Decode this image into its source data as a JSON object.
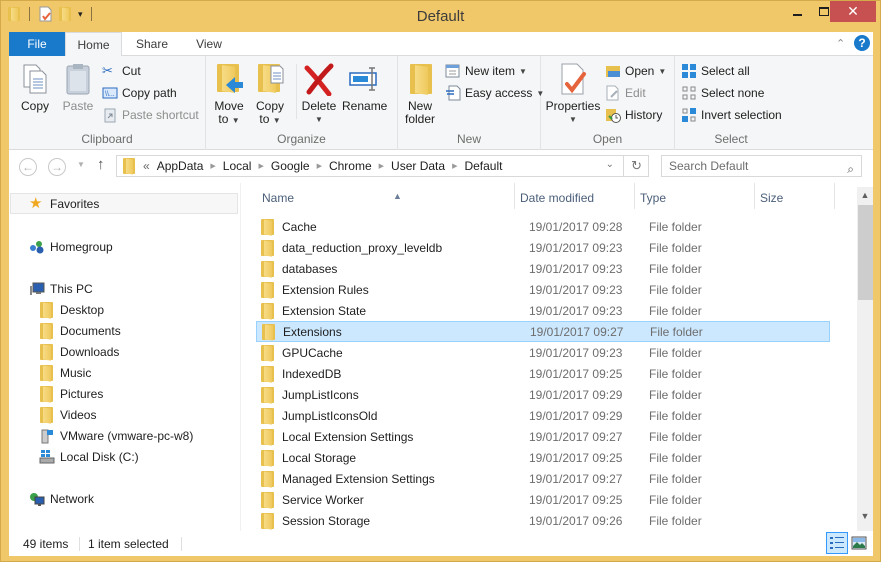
{
  "window": {
    "title": "Default",
    "accent_color": "#f0c86a",
    "close_color": "#c75050"
  },
  "quick_access": {
    "icons": [
      "folder-icon",
      "properties-icon",
      "new-folder-icon",
      "customize-dropdown-icon"
    ]
  },
  "tabs": [
    {
      "label": "File",
      "active": false
    },
    {
      "label": "Home",
      "active": true
    },
    {
      "label": "Share",
      "active": false
    },
    {
      "label": "View",
      "active": false
    }
  ],
  "ribbon": {
    "clipboard": {
      "label": "Clipboard",
      "copy": "Copy",
      "paste": "Paste",
      "cut": "Cut",
      "copy_path": "Copy path",
      "paste_shortcut": "Paste shortcut"
    },
    "organize": {
      "label": "Organize",
      "move_to_1": "Move",
      "move_to_2": "to",
      "copy_to_1": "Copy",
      "copy_to_2": "to",
      "delete": "Delete",
      "rename": "Rename"
    },
    "new": {
      "label": "New",
      "new_folder_1": "New",
      "new_folder_2": "folder",
      "new_item": "New item",
      "easy_access": "Easy access"
    },
    "open": {
      "label": "Open",
      "properties": "Properties",
      "open": "Open",
      "edit": "Edit",
      "history": "History"
    },
    "select": {
      "label": "Select",
      "select_all": "Select all",
      "select_none": "Select none",
      "invert_selection": "Invert selection"
    }
  },
  "address": {
    "overflow": "«",
    "crumbs": [
      "AppData",
      "Local",
      "Google",
      "Chrome",
      "User Data",
      "Default"
    ],
    "search_placeholder": "Search Default"
  },
  "navpane": {
    "favorites": "Favorites",
    "homegroup": "Homegroup",
    "this_pc": "This PC",
    "pc_items": [
      "Desktop",
      "Documents",
      "Downloads",
      "Music",
      "Pictures",
      "Videos",
      "VMware (vmware-pc-w8)",
      "Local Disk (C:)"
    ],
    "network": "Network"
  },
  "columns": {
    "name": "Name",
    "date": "Date modified",
    "type": "Type",
    "size": "Size"
  },
  "files": [
    {
      "name": "Cache",
      "date": "19/01/2017 09:28",
      "type": "File folder",
      "selected": false
    },
    {
      "name": "data_reduction_proxy_leveldb",
      "date": "19/01/2017 09:23",
      "type": "File folder",
      "selected": false
    },
    {
      "name": "databases",
      "date": "19/01/2017 09:23",
      "type": "File folder",
      "selected": false
    },
    {
      "name": "Extension Rules",
      "date": "19/01/2017 09:23",
      "type": "File folder",
      "selected": false
    },
    {
      "name": "Extension State",
      "date": "19/01/2017 09:23",
      "type": "File folder",
      "selected": false
    },
    {
      "name": "Extensions",
      "date": "19/01/2017 09:27",
      "type": "File folder",
      "selected": true
    },
    {
      "name": "GPUCache",
      "date": "19/01/2017 09:23",
      "type": "File folder",
      "selected": false
    },
    {
      "name": "IndexedDB",
      "date": "19/01/2017 09:25",
      "type": "File folder",
      "selected": false
    },
    {
      "name": "JumpListIcons",
      "date": "19/01/2017 09:29",
      "type": "File folder",
      "selected": false
    },
    {
      "name": "JumpListIconsOld",
      "date": "19/01/2017 09:29",
      "type": "File folder",
      "selected": false
    },
    {
      "name": "Local Extension Settings",
      "date": "19/01/2017 09:27",
      "type": "File folder",
      "selected": false
    },
    {
      "name": "Local Storage",
      "date": "19/01/2017 09:25",
      "type": "File folder",
      "selected": false
    },
    {
      "name": "Managed Extension Settings",
      "date": "19/01/2017 09:27",
      "type": "File folder",
      "selected": false
    },
    {
      "name": "Service Worker",
      "date": "19/01/2017 09:25",
      "type": "File folder",
      "selected": false
    },
    {
      "name": "Session Storage",
      "date": "19/01/2017 09:26",
      "type": "File folder",
      "selected": false
    }
  ],
  "status": {
    "item_count": "49 items",
    "selection": "1 item selected"
  }
}
